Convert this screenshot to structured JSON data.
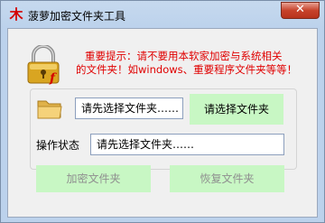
{
  "window": {
    "title": "菠萝加密文件夹工具",
    "app_icon_glyph": "木",
    "close_glyph": "✕"
  },
  "warning": {
    "line1": "重要提示：请不要用本软家加密与系统相关",
    "line2": "的文件夹！如windows、重要程序文件夹等等！"
  },
  "folder_picker": {
    "path_value": "请先选择文件夹……",
    "choose_button": "请选择文件夹"
  },
  "status": {
    "label": "操作状态",
    "value": "请先选择文件夹……"
  },
  "actions": {
    "encrypt_button": "加密文件夹",
    "restore_button": "恢复文件夹"
  },
  "colors": {
    "warning_text": "#e00000",
    "button_bg": "#c8f7c4",
    "disabled_text": "#8f8f8f",
    "close_button": "#c7432b"
  },
  "icons": [
    "app-icon",
    "close-icon",
    "lock-icon",
    "folder-icon"
  ]
}
